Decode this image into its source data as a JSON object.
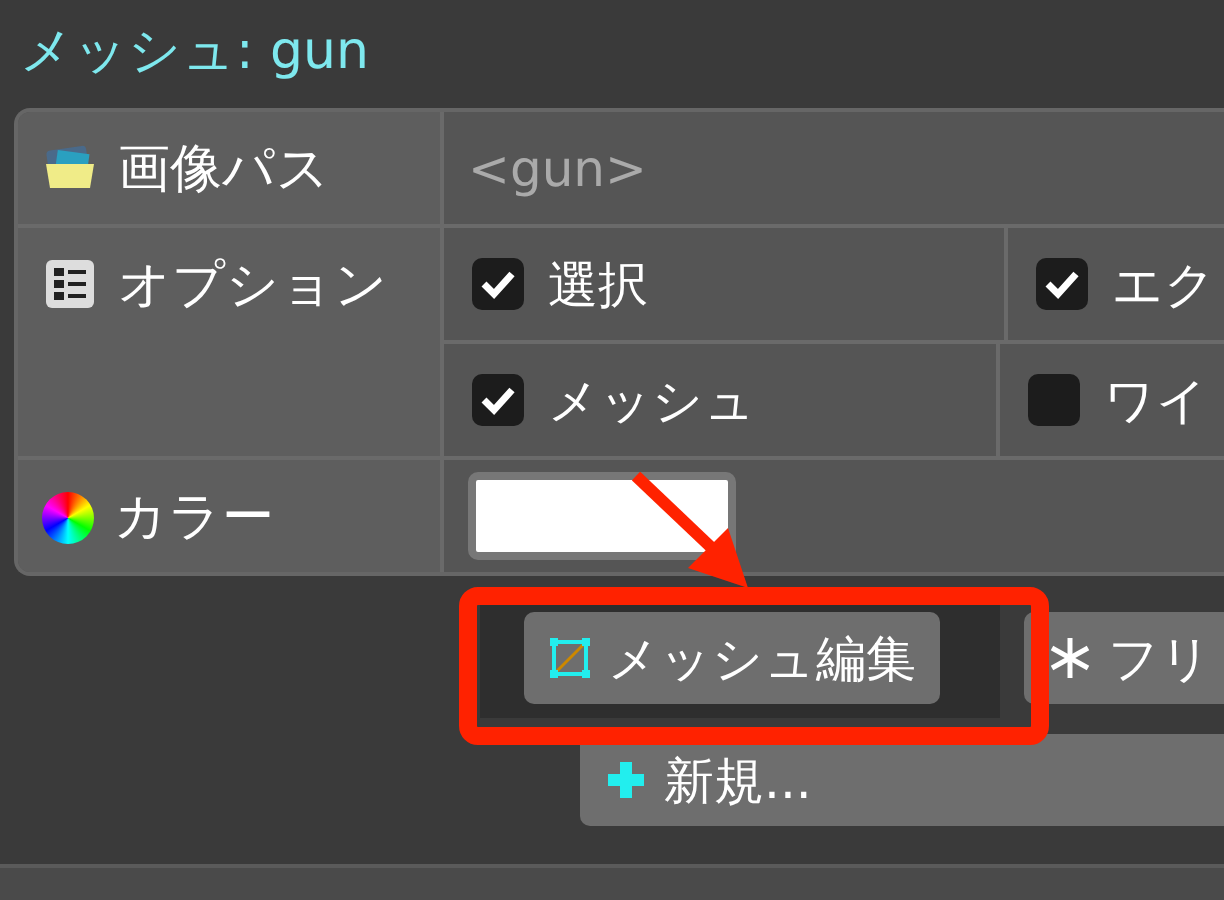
{
  "title": "メッシュ: gun",
  "properties": [
    {
      "kind": "path",
      "label": "画像パス",
      "value": "<gun>"
    },
    {
      "kind": "options",
      "label": "オプション",
      "options": [
        [
          {
            "label": "選択",
            "checked": true
          },
          {
            "label": "エク",
            "checked": true
          }
        ],
        [
          {
            "label": "メッシュ",
            "checked": true
          },
          {
            "label": "ワイ",
            "checked": false
          }
        ]
      ]
    },
    {
      "kind": "color",
      "label": "カラー",
      "color": "#ffffff"
    }
  ],
  "buttons": [
    {
      "label": "メッシュ編集",
      "highlighted": true
    },
    {
      "label": "フリ",
      "highlighted": false
    }
  ],
  "new_button": "新規..."
}
